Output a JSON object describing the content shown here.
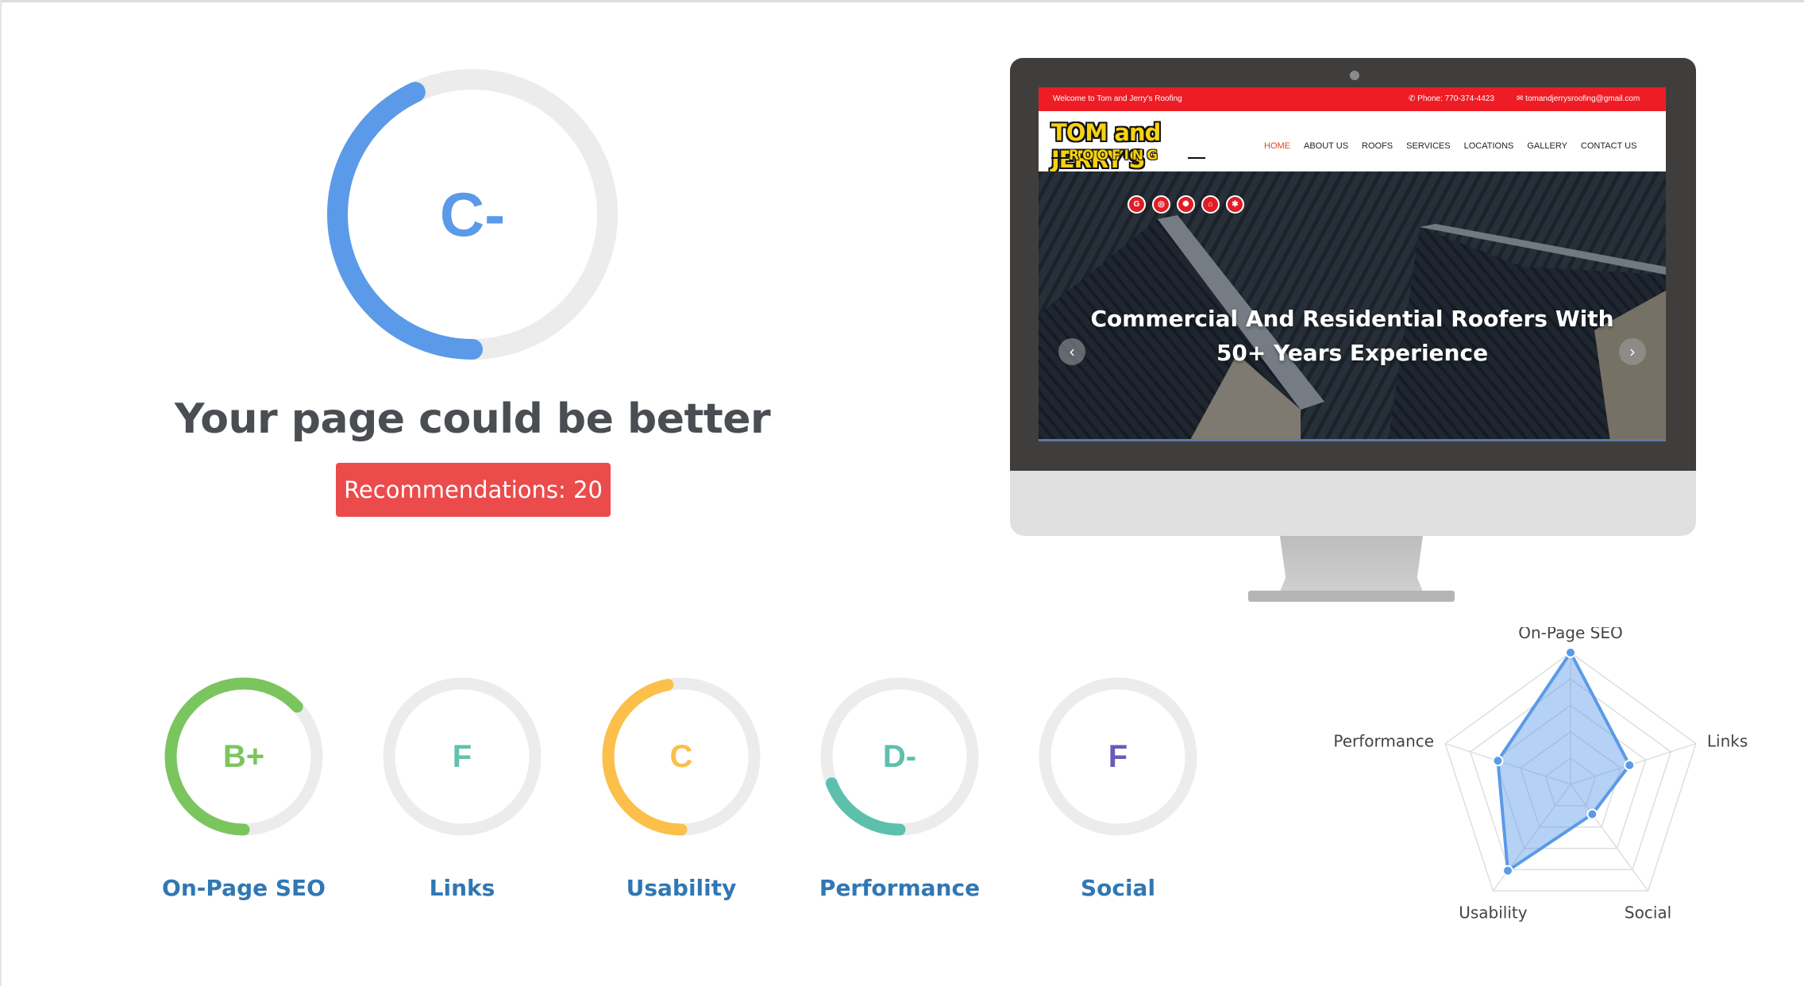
{
  "overall": {
    "grade": "C-",
    "score_fraction": 0.43,
    "color": "#5b9ae8",
    "headline": "Your page could be better",
    "recommendations_label": "Recommendations: 20"
  },
  "preview": {
    "topbar": {
      "welcome": "Welcome to Tom and Jerry's Roofing",
      "phone": "Phone: 770-374-4423",
      "email": "tomandjerrysroofing@gmail.com"
    },
    "logo": {
      "line1": "TOM and JERRY'S",
      "line2": "ROOFING"
    },
    "nav": [
      "HOME",
      "ABOUT US",
      "ROOFS",
      "SERVICES",
      "LOCATIONS",
      "GALLERY",
      "CONTACT US"
    ],
    "social_icons": [
      "google-icon",
      "instagram-icon",
      "dribbble-icon",
      "home-icon",
      "yelp-icon"
    ],
    "hero_title": "Commercial And Residential Roofers With 50+ Years Experience",
    "prev_arrow": "‹",
    "next_arrow": "›"
  },
  "categories": [
    {
      "label": "On-Page SEO",
      "grade": "B+",
      "score_fraction": 0.63,
      "color": "#7ac55e"
    },
    {
      "label": "Links",
      "grade": "F",
      "score_fraction": 0.0,
      "color": "#62c0ad"
    },
    {
      "label": "Usability",
      "grade": "C",
      "score_fraction": 0.47,
      "color": "#fbbf4a"
    },
    {
      "label": "Performance",
      "grade": "D-",
      "score_fraction": 0.19,
      "color": "#5cc0ac"
    },
    {
      "label": "Social",
      "grade": "F",
      "score_fraction": 0.0,
      "color": "#6b5bb8"
    }
  ],
  "chart_data": {
    "type": "radar",
    "axes": [
      "On-Page SEO",
      "Links",
      "Social",
      "Usability",
      "Performance"
    ],
    "values": [
      1.0,
      0.47,
      0.28,
      0.81,
      0.58
    ],
    "max": 1.0,
    "color": "#5b9ae8"
  }
}
